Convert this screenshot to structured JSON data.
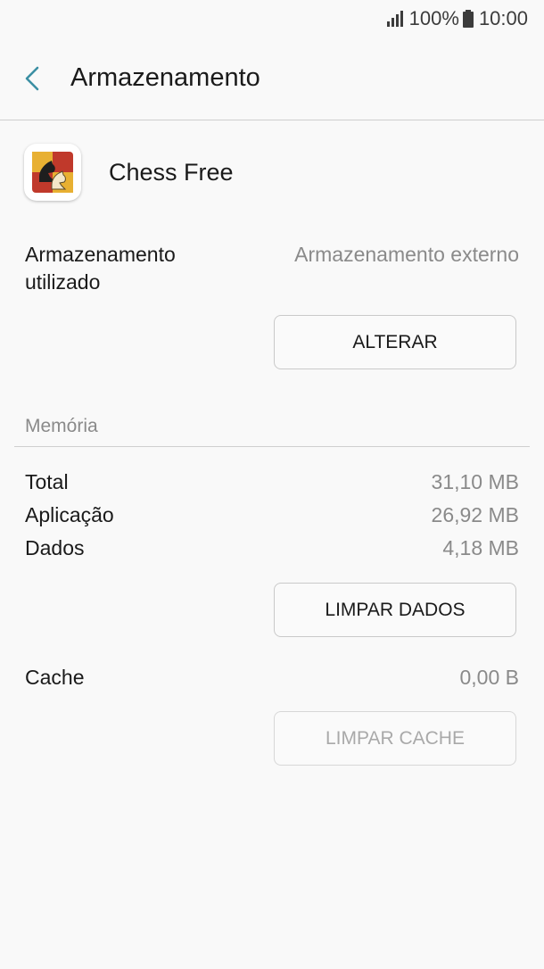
{
  "status_bar": {
    "battery_percent": "100%",
    "time": "10:00",
    "icons": [
      "signal-icon",
      "battery-icon"
    ]
  },
  "header": {
    "back_icon": "chevron-left-icon",
    "title": "Armazenamento",
    "accent_color": "#3b8fa3"
  },
  "app": {
    "name": "Chess Free",
    "icon": "chess-knight-icon"
  },
  "storage": {
    "label": "Armazenamento utilizado",
    "value": "Armazenamento externo",
    "change_button": "ALTERAR"
  },
  "memory": {
    "section_title": "Memória",
    "rows": [
      {
        "label": "Total",
        "value": "31,10 MB"
      },
      {
        "label": "Aplicação",
        "value": "26,92 MB"
      },
      {
        "label": "Dados",
        "value": "4,18 MB"
      }
    ],
    "clear_data_button": "LIMPAR DADOS"
  },
  "cache": {
    "label": "Cache",
    "value": "0,00 B",
    "clear_cache_button": "LIMPAR CACHE",
    "clear_cache_enabled": false
  }
}
